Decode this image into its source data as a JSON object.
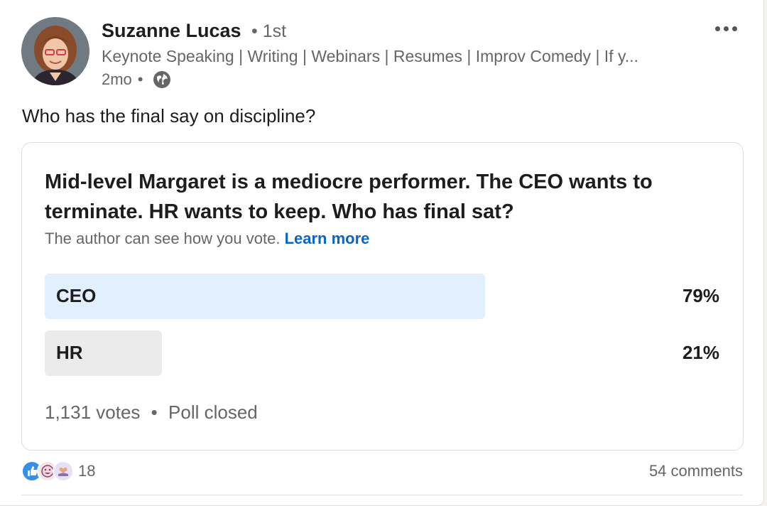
{
  "post": {
    "author": {
      "name": "Suzanne Lucas",
      "degree": "• 1st",
      "headline": "Keynote Speaking | Writing | Webinars | Resumes | Improv Comedy | If y...",
      "time": "2mo",
      "visibility_icon": "globe-icon"
    },
    "more_icon": "more-horizontal-icon",
    "text": "Who has the final say on discipline?"
  },
  "poll": {
    "question": "Mid-level Margaret is a mediocre performer. The CEO wants to terminate. HR wants to keep. Who has final sat?",
    "note": "The author can see how you vote.",
    "learn_more": "Learn more",
    "options": [
      {
        "label": "CEO",
        "percent_text": "79%",
        "percent": 79,
        "leading": true
      },
      {
        "label": "HR",
        "percent_text": "21%",
        "percent": 21,
        "leading": false
      }
    ],
    "votes": "1,131 votes",
    "status": "Poll closed"
  },
  "social": {
    "reaction_icons": [
      "like-icon",
      "funny-icon",
      "support-icon"
    ],
    "reaction_count": "18",
    "comments": "54 comments"
  },
  "colors": {
    "leading_bar": "#e2effe",
    "other_bar": "#ebebeb",
    "link": "#0a66c2"
  }
}
